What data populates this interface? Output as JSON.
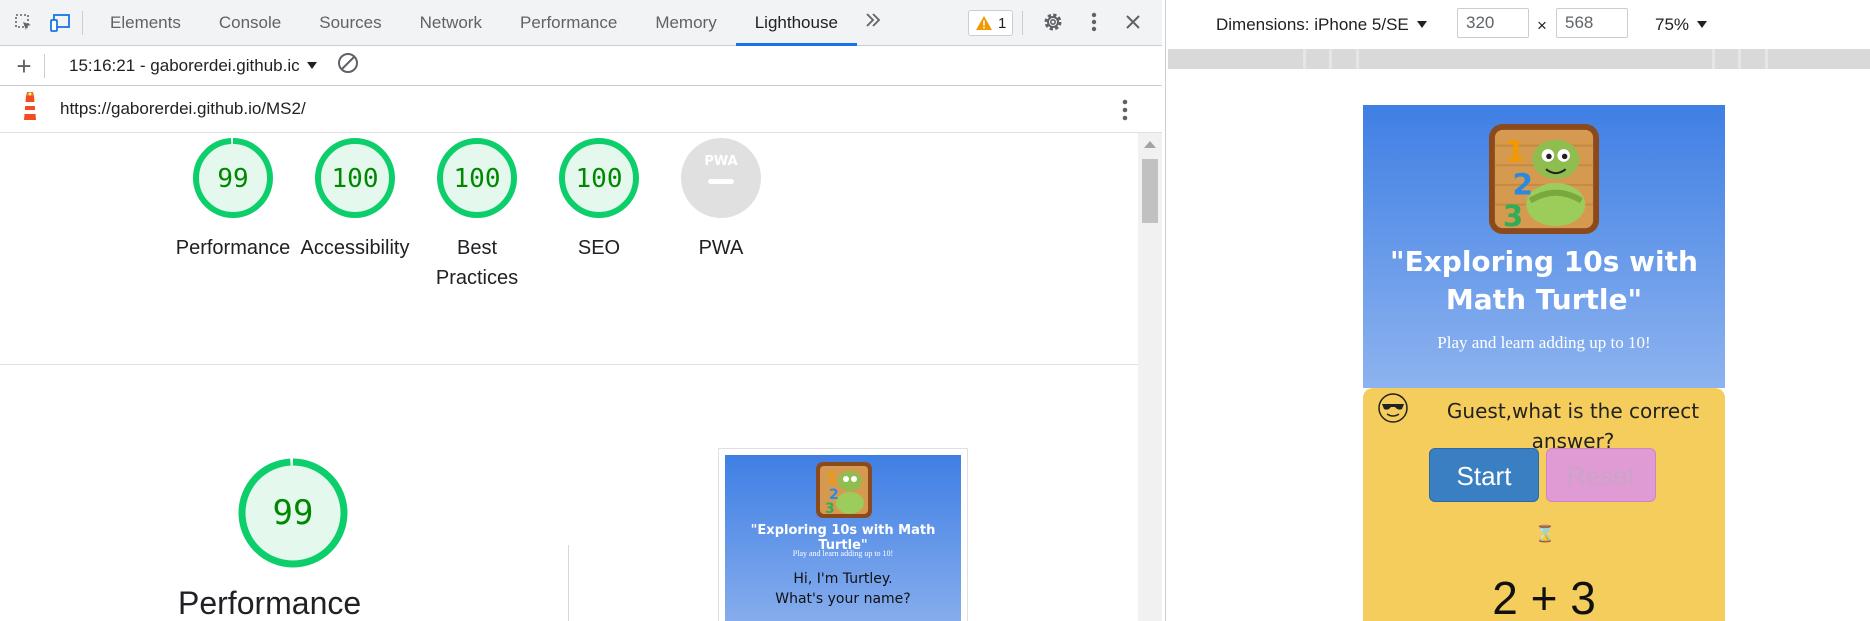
{
  "devtools": {
    "tabs": [
      "Elements",
      "Console",
      "Sources",
      "Network",
      "Performance",
      "Memory",
      "Lighthouse"
    ],
    "active_tab": "Lighthouse",
    "more_tabs_icon": "chevron-double-right-icon",
    "warnings_count": "1",
    "report_selector": "15:16:21 - gaborerdei.github.ic",
    "url": "https://gaborerdei.github.io/MS2/"
  },
  "scores": [
    {
      "label": "Performance",
      "value": "99",
      "percent": 99
    },
    {
      "label": "Accessibility",
      "value": "100",
      "percent": 100
    },
    {
      "label": "Best",
      "label2": "Practices",
      "value": "100",
      "percent": 100
    },
    {
      "label": "SEO",
      "value": "100",
      "percent": 100
    },
    {
      "label": "PWA",
      "value": "PWA",
      "percent": 0
    }
  ],
  "performance_section": {
    "score": "99",
    "title": "Performance"
  },
  "thumbnail": {
    "title": "\"Exploring 10s with Math Turtle\"",
    "subtitle": "Play and learn adding up to 10!",
    "greeting_line1": "Hi, I'm Turtley.",
    "greeting_line2": "What's your name?"
  },
  "device_toolbar": {
    "dimensions_label": "Dimensions: iPhone 5/SE",
    "width": "320",
    "height": "568",
    "times": "×",
    "zoom": "75%"
  },
  "device_page": {
    "title": "\"Exploring 10s with Math Turtle\"",
    "subtitle": "Play and learn adding up to 10!",
    "question": "Guest,what is the correct answer?",
    "start_label": "Start",
    "reset_label": "Reset",
    "timer_icon": "⌛",
    "equation": "2 + 3"
  },
  "colors": {
    "accent": "#1a73e8",
    "score_green": "#0cce6b",
    "score_text": "#008800",
    "score_bg": "#e5f8ee",
    "page_blue": "#3f7fe4",
    "page_yellow": "#f5cd5c"
  }
}
